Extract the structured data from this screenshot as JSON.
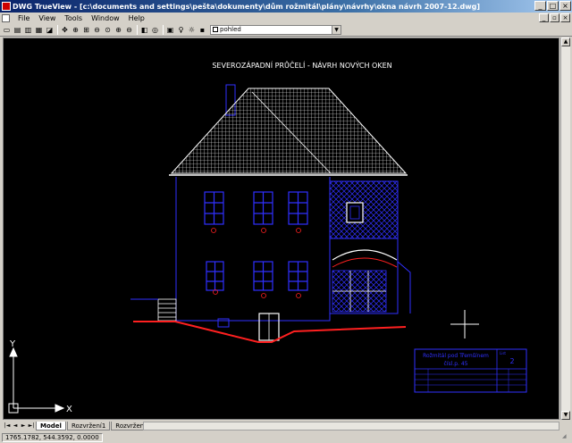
{
  "window": {
    "title": "DWG TrueView - [c:\\documents and settings\\pešta\\dokumenty\\dům rožmitál\\plány\\návrhy\\okna návrh 2007-12.dwg]",
    "minimize": "_",
    "maximize": "□",
    "close": "×"
  },
  "menu": {
    "items": [
      "File",
      "View",
      "Tools",
      "Window",
      "Help"
    ]
  },
  "toolbar": {
    "layer_value": "pohled"
  },
  "drawing": {
    "title": "SEVEROZÁPADNÍ PRŮČELÍ - NÁVRH NOVÝCH OKEN",
    "ucs_x": "X",
    "ucs_y": "Y",
    "title_block": {
      "line1": "Rožmitál pod Třemšínem",
      "line2": "čísl.p. 45",
      "sheet_label": "List",
      "sheet_number": "2"
    }
  },
  "tabs": [
    "Model",
    "Rozvržení1",
    "Rozvržení2"
  ],
  "status": {
    "coords": "1765.1782, 544.3592, 0.0000"
  },
  "colors": {
    "background": "#000000",
    "line_white": "#ffffff",
    "line_blue": "#3030ff",
    "ground_red": "#ff2020"
  }
}
